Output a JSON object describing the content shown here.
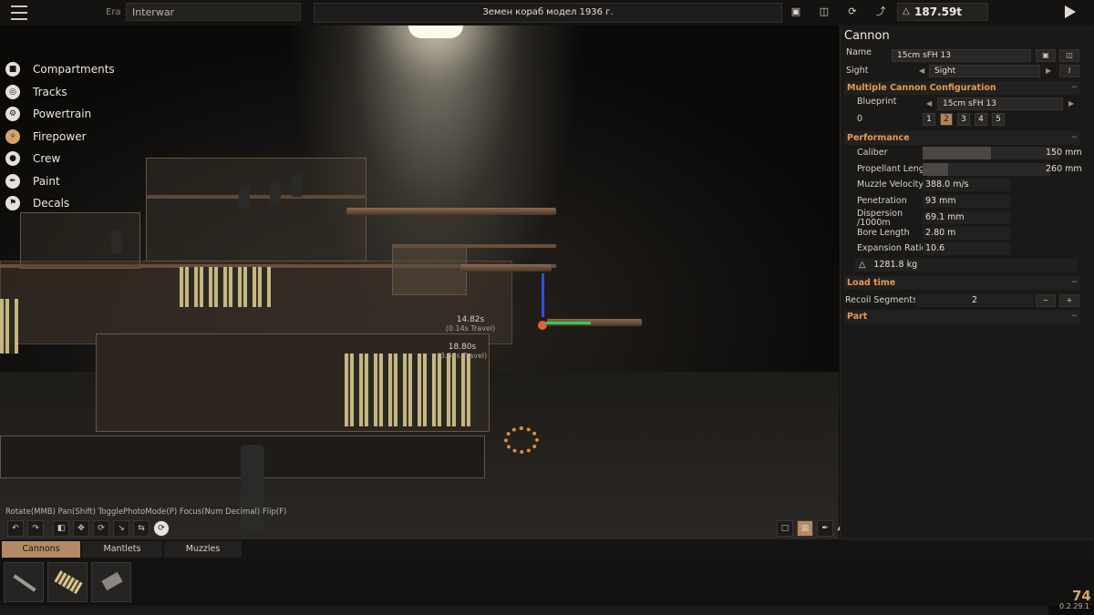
{
  "topbar": {
    "era_label": "Era",
    "era_value": "Interwar",
    "vehicle_name": "Земен кораб модел 1936 г.",
    "weight": "187.59t",
    "icons": [
      "menu-icon",
      "save-icon",
      "folder-icon",
      "refresh-icon",
      "paint-icon",
      "weight-icon",
      "play-icon"
    ]
  },
  "nav": {
    "items": [
      {
        "label": "Compartments",
        "icon": "box-icon"
      },
      {
        "label": "Tracks",
        "icon": "track-icon"
      },
      {
        "label": "Powertrain",
        "icon": "gear-icon"
      },
      {
        "label": "Firepower",
        "icon": "cannon-icon"
      },
      {
        "label": "Crew",
        "icon": "person-icon"
      },
      {
        "label": "Paint",
        "icon": "brush-icon"
      },
      {
        "label": "Decals",
        "icon": "decal-icon"
      }
    ]
  },
  "viewport": {
    "annotations": [
      {
        "time": "14.82s",
        "note": "(0.14s Travel)"
      },
      {
        "time": "18.80s",
        "note": "(3.58s Travel)"
      }
    ],
    "controls_hint": "Rotate(MMB) Pan(Shift) TogglePhotoMode(P) Focus(Num Decimal) Flip(F)"
  },
  "panel": {
    "title": "Cannon",
    "name_label": "Name",
    "name_value": "15cm sFH 13",
    "sight_label": "Sight",
    "sight_value": "Sight",
    "sight_btn": "I",
    "multi_section": "Multiple Cannon Configuration",
    "blueprint_label": "Blueprint",
    "blueprint_value": "15cm sFH 13",
    "index_label": "0",
    "counts": [
      "1",
      "2",
      "3",
      "4",
      "5"
    ],
    "selected_count": "2",
    "performance_section": "Performance",
    "caliber_label": "Caliber",
    "caliber_value": "150 mm",
    "caliber_fill": 0.5,
    "propellant_label": "Propellant Length",
    "propellant_value": "260 mm",
    "propellant_fill": 0.2,
    "stats": [
      {
        "label": "Muzzle Velocity",
        "value": "388.0 m/s"
      },
      {
        "label": "Penetration",
        "value": "93 mm"
      },
      {
        "label": "Dispersion /1000m",
        "value": "69.1 mm"
      },
      {
        "label": "Bore Length",
        "value": "2.80 m"
      },
      {
        "label": "Expansion Ratio",
        "value": "10.6"
      }
    ],
    "mass": "1281.8 kg",
    "load_section": "Load time",
    "recoil_label": "Recoil Segments",
    "recoil_value": "2",
    "minus": "−",
    "plus": "+",
    "part_section": "Part",
    "collapse": "−"
  },
  "bottom": {
    "tabs": [
      "Cannons",
      "Mantlets",
      "Muzzles"
    ],
    "version_num": "74",
    "version": "0.2.29.1"
  },
  "colors": {
    "accent": "#e59a50",
    "selected": "#b38a63"
  }
}
